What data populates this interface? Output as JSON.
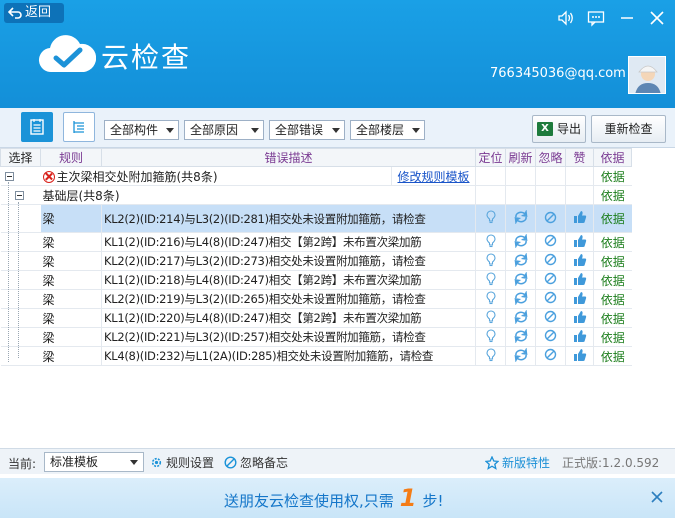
{
  "header": {
    "back_label": "返回",
    "app_title": "云检查",
    "user_email": "766345036@qq.com"
  },
  "toolbar": {
    "filters": [
      "全部构件",
      "全部原因",
      "全部错误",
      "全部楼层"
    ],
    "export_label": "导出",
    "recheck_label": "重新检查"
  },
  "table": {
    "columns": [
      "选择",
      "规则",
      "错误描述",
      "定位",
      "刷新",
      "忽略",
      "赞",
      "依据"
    ],
    "group": {
      "title": "主次梁相交处附加箍筋(共8条)",
      "link": "修改规则模板",
      "basis": "依据"
    },
    "subgroup": {
      "title": "基础层(共8条)",
      "basis": "依据"
    },
    "rows": [
      {
        "rule": "梁",
        "desc": "KL2(2)(ID:214)与L3(2)(ID:281)相交处未设置附加箍筋，请检查",
        "basis": "依据"
      },
      {
        "rule": "梁",
        "desc": "KL1(2)(ID:216)与L4(8)(ID:247)相交【第2跨】未布置次梁加筋",
        "basis": "依据"
      },
      {
        "rule": "梁",
        "desc": "KL2(2)(ID:217)与L3(2)(ID:273)相交处未设置附加箍筋，请检查",
        "basis": "依据"
      },
      {
        "rule": "梁",
        "desc": "KL1(2)(ID:218)与L4(8)(ID:247)相交【第2跨】未布置次梁加筋",
        "basis": "依据"
      },
      {
        "rule": "梁",
        "desc": "KL2(2)(ID:219)与L3(2)(ID:265)相交处未设置附加箍筋，请检查",
        "basis": "依据"
      },
      {
        "rule": "梁",
        "desc": "KL1(2)(ID:220)与L4(8)(ID:247)相交【第2跨】未布置次梁加筋",
        "basis": "依据"
      },
      {
        "rule": "梁",
        "desc": "KL2(2)(ID:221)与L3(2)(ID:257)相交处未设置附加箍筋，请检查",
        "basis": "依据"
      },
      {
        "rule": "梁",
        "desc": "KL4(8)(ID:232)与L1(2A)(ID:285)相交处未设置附加箍筋，请检查",
        "basis": "依据"
      }
    ]
  },
  "status": {
    "current_label": "当前:",
    "template_value": "标准模板",
    "rule_settings": "规则设置",
    "ignore_notes": "忽略备忘",
    "new_features": "新版特性",
    "version": "正式版:1.2.0.592"
  },
  "banner": {
    "text_before": "送朋友云检查使用权,只需",
    "number": "1",
    "text_after": "步!"
  },
  "colors": {
    "header_blue": "#138fd8",
    "accent_blue": "#1b93d8",
    "basis_green": "#1a7d1a",
    "banner_orange": "#f47c16"
  }
}
